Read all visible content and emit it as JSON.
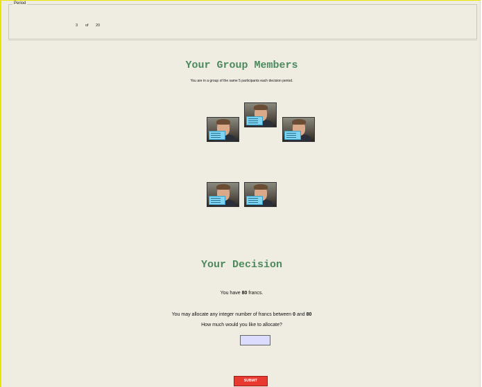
{
  "period": {
    "legend": "Period",
    "current": "3",
    "of": "of",
    "total": "20"
  },
  "group": {
    "title": "Your Group Members",
    "subtitle": "You are in a group of the same 5 participants each decision period.",
    "members": [
      {
        "icon": "participant-photo"
      },
      {
        "icon": "participant-photo"
      },
      {
        "icon": "participant-photo"
      },
      {
        "icon": "participant-photo"
      },
      {
        "icon": "participant-photo"
      }
    ]
  },
  "decision": {
    "title": "Your Decision",
    "francs_prefix": "You have ",
    "francs_amount": "80",
    "francs_suffix": " francs.",
    "range_prefix": "You may allocate any integer number of francs between ",
    "range_min": "0",
    "range_and": " and ",
    "range_max": "80",
    "prompt": "How much would you like to allocate?",
    "input_value": "",
    "submit_label": "SUBMIT"
  },
  "colors": {
    "background": "#efece1",
    "heading": "#4c8a5e",
    "submit": "#e83a30",
    "input": "#dcdcff"
  }
}
